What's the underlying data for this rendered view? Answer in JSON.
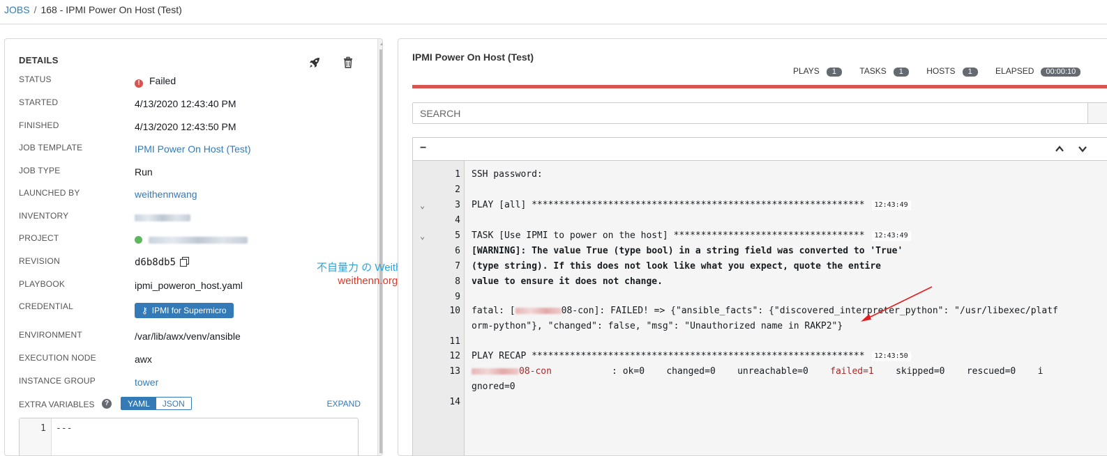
{
  "breadcrumb": {
    "root": "JOBS",
    "separator": "/",
    "current": "168 - IPMI Power On Host (Test)"
  },
  "details": {
    "title": "DETAILS",
    "icons": {
      "relaunch": "rocket-icon",
      "delete": "trash-icon"
    },
    "status": {
      "label": "STATUS",
      "value": "Failed",
      "color": "#d9534f"
    },
    "started": {
      "label": "STARTED",
      "value": "4/13/2020 12:43:40 PM"
    },
    "finished": {
      "label": "FINISHED",
      "value": "4/13/2020 12:43:50 PM"
    },
    "job_template": {
      "label": "JOB TEMPLATE",
      "value": "IPMI Power On Host (Test)"
    },
    "job_type": {
      "label": "JOB TYPE",
      "value": "Run"
    },
    "launched_by": {
      "label": "LAUNCHED BY",
      "value": "weithennwang"
    },
    "inventory": {
      "label": "INVENTORY"
    },
    "project": {
      "label": "PROJECT",
      "status_color": "#5cb85c"
    },
    "revision": {
      "label": "REVISION",
      "value": "d6b8db5"
    },
    "playbook": {
      "label": "PLAYBOOK",
      "value": "ipmi_poweron_host.yaml"
    },
    "credential": {
      "label": "CREDENTIAL",
      "value": "IPMI for Supermicro"
    },
    "environment": {
      "label": "ENVIRONMENT",
      "value": "/var/lib/awx/venv/ansible"
    },
    "execution_node": {
      "label": "EXECUTION NODE",
      "value": "awx"
    },
    "instance_group": {
      "label": "INSTANCE GROUP",
      "value": "tower"
    },
    "extra_variables": {
      "label": "EXTRA VARIABLES",
      "help": "?",
      "toggle_yaml": "YAML",
      "toggle_json": "JSON",
      "expand": "EXPAND",
      "line_number": "1",
      "code": "---"
    }
  },
  "output": {
    "title": "IPMI Power On Host (Test)",
    "stats": {
      "plays_label": "PLAYS",
      "plays": "1",
      "tasks_label": "TASKS",
      "tasks": "1",
      "hosts_label": "HOSTS",
      "hosts": "1",
      "elapsed_label": "ELAPSED",
      "elapsed": "00:00:10"
    },
    "progress_color": "#d9534f",
    "search_placeholder": "SEARCH",
    "collapse": "−",
    "lines": [
      {
        "num": "1",
        "text": "SSH password:"
      },
      {
        "num": "2",
        "text": ""
      },
      {
        "num": "3",
        "text": "PLAY [all] *************************************************************",
        "ts": "12:43:49"
      },
      {
        "num": "4",
        "text": ""
      },
      {
        "num": "5",
        "text": "TASK [Use IPMI to power on the host] ***********************************",
        "ts": "12:43:49"
      },
      {
        "num": "6",
        "text": "[WARNING]: The value True (type bool) in a string field was converted to 'True'"
      },
      {
        "num": "7",
        "text": "(type string). If this does not look like what you expect, quote the entire"
      },
      {
        "num": "8",
        "text": "value to ensure it does not change."
      },
      {
        "num": "9",
        "text": ""
      },
      {
        "num": "10",
        "text_a": "fatal: [",
        "text_b": "08-con]: FAILED! => {\"ansible_facts\": {\"discovered_interpreter_python\": \"/usr/libexec/platf",
        "text_c": "orm-python\"}, \"changed\": false, \"msg\": \"Unauthorized name in RAKP2\"}"
      },
      {
        "num": "11",
        "text": ""
      },
      {
        "num": "12",
        "text": "PLAY RECAP *************************************************************",
        "ts": "12:43:50"
      },
      {
        "num": "13",
        "host": "08-con",
        "stats_a": "           : ok=0    changed=0    unreachable=0    ",
        "failed": "failed=1",
        "stats_b": "    skipped=0    rescued=0    i",
        "cont": "gnored=0"
      },
      {
        "num": "14",
        "text": ""
      }
    ]
  },
  "watermark": {
    "line1": "不自量力 の Weithenn",
    "line2": "weithenn.org"
  }
}
